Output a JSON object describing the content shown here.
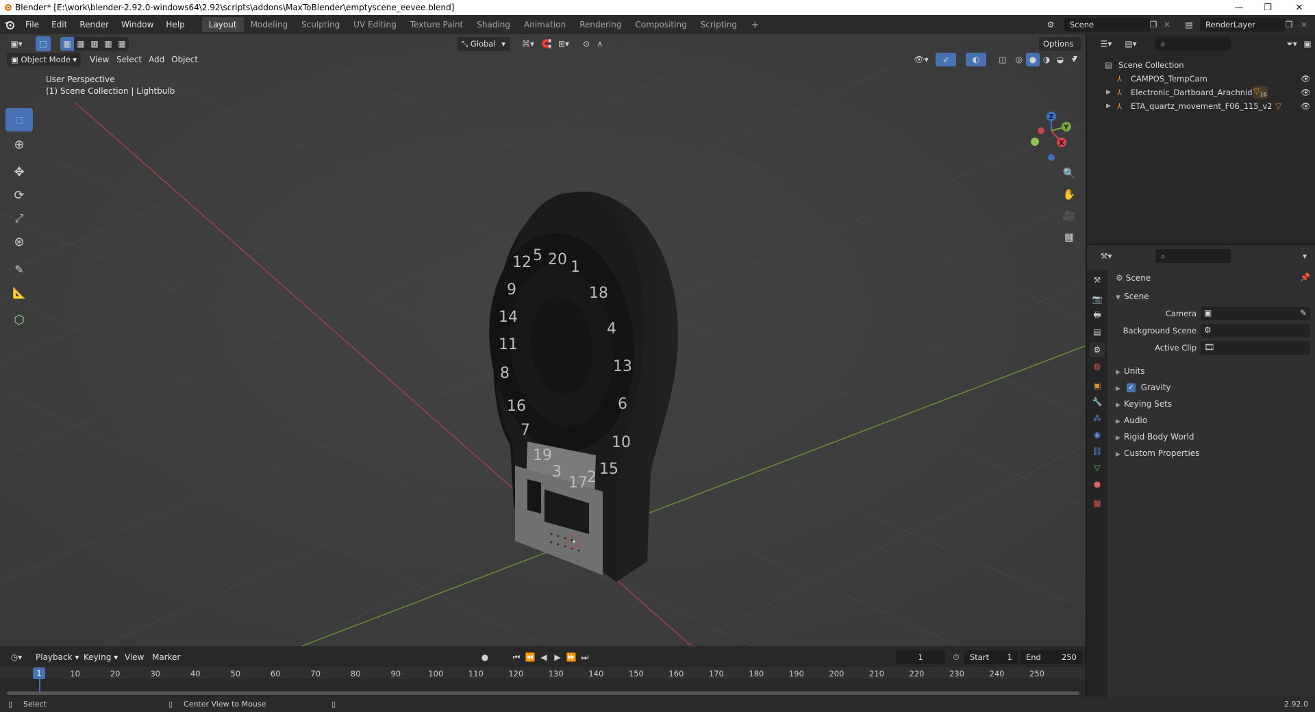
{
  "window": {
    "title": "Blender* [E:\\work\\blender-2.92.0-windows64\\2.92\\scripts\\addons\\MaxToBlender\\emptyscene_eevee.blend]",
    "minimize": "—",
    "restore": "❐",
    "close": "✕"
  },
  "menubar": {
    "items": [
      "File",
      "Edit",
      "Render",
      "Window",
      "Help"
    ],
    "workspaces": [
      "Layout",
      "Modeling",
      "Sculpting",
      "UV Editing",
      "Texture Paint",
      "Shading",
      "Animation",
      "Rendering",
      "Compositing",
      "Scripting"
    ],
    "active_workspace": "Layout",
    "add_workspace": "+",
    "scene": "Scene",
    "view_layer": "RenderLayer"
  },
  "viewport": {
    "mode": "Object Mode",
    "menus": [
      "View",
      "Select",
      "Add",
      "Object"
    ],
    "transform_orientation": "Global",
    "options": "Options",
    "info_line1": "User Perspective",
    "info_line2": "(1) Scene Collection | Lightbulb",
    "gizmo": {
      "z": "Z",
      "y": "Y",
      "x": "X"
    },
    "dartboard_numbers": [
      "12",
      "5",
      "20",
      "1",
      "18",
      "4",
      "13",
      "6",
      "10",
      "15",
      "2",
      "17",
      "3",
      "19",
      "7",
      "16",
      "8",
      "11",
      "14",
      "9"
    ]
  },
  "outliner": {
    "root": "Scene Collection",
    "items": [
      {
        "name": "CAMPOS_TempCam",
        "badge": ""
      },
      {
        "name": "Electronic_Dartboard_Arachnid",
        "badge": "16"
      },
      {
        "name": "ETA_quartz_movement_F06_115_v2",
        "badge": ""
      }
    ]
  },
  "properties": {
    "context": "Scene",
    "panel": "Scene",
    "fields": [
      {
        "label": "Camera",
        "value": ""
      },
      {
        "label": "Background Scene",
        "value": ""
      },
      {
        "label": "Active Clip",
        "value": ""
      }
    ],
    "subpanels": [
      "Units",
      "Gravity",
      "Keying Sets",
      "Audio",
      "Rigid Body World",
      "Custom Properties"
    ],
    "gravity_checked": true
  },
  "timeline": {
    "menus": [
      "Playback",
      "Keying",
      "View",
      "Marker"
    ],
    "current_frame": "1",
    "start_label": "Start",
    "start": "1",
    "end_label": "End",
    "end": "250",
    "ruler": [
      "1",
      "10",
      "20",
      "30",
      "40",
      "50",
      "60",
      "70",
      "80",
      "90",
      "100",
      "110",
      "120",
      "130",
      "140",
      "150",
      "160",
      "170",
      "180",
      "190",
      "200",
      "210",
      "220",
      "230",
      "240",
      "250"
    ]
  },
  "statusbar": {
    "select": "Select",
    "center_view": "Center View to Mouse",
    "version": "2.92.0"
  },
  "colors": {
    "accent": "#4772b3",
    "viewport_bg": "#3d3d3d",
    "x_axis": "#c0404a",
    "y_axis": "#7aa83a",
    "object_icon": "#e0913a"
  }
}
